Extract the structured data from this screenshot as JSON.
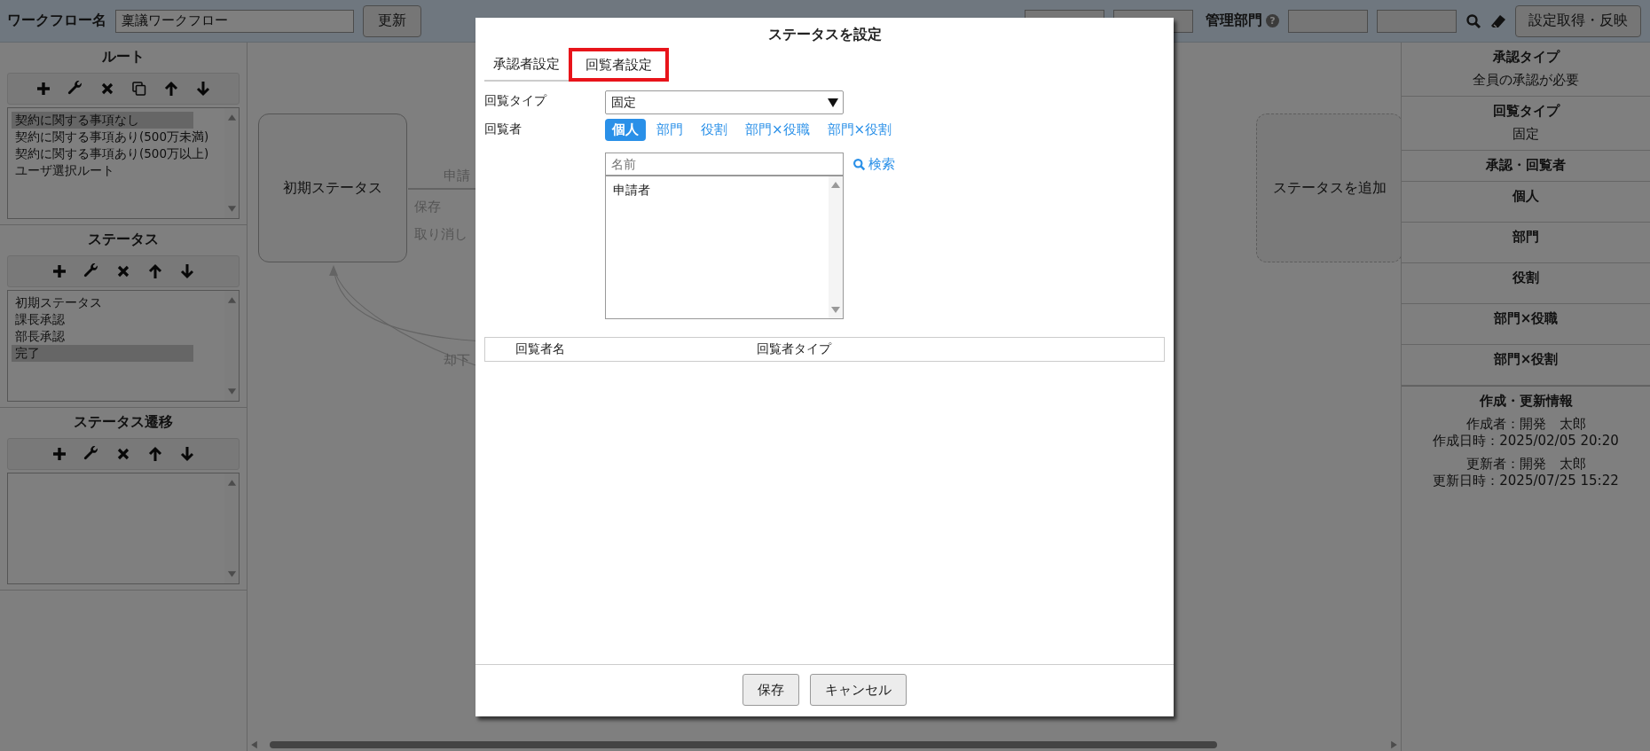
{
  "header": {
    "workflow_label": "ワークフロー名",
    "workflow_name": "稟議ワークフロー",
    "update_button": "更新",
    "department_label": "管理部門",
    "help_mark": "?",
    "apply_button": "設定取得・反映"
  },
  "sidebar": {
    "sections": [
      {
        "title": "ルート",
        "tools": [
          {
            "kind": "add"
          },
          {
            "kind": "edit"
          },
          {
            "kind": "delete"
          },
          {
            "kind": "copy"
          },
          {
            "kind": "up"
          },
          {
            "kind": "down"
          }
        ],
        "items": [
          {
            "label": "契約に関する事項なし",
            "selected": true
          },
          {
            "label": "契約に関する事項あり(500万未満)",
            "selected": false
          },
          {
            "label": "契約に関する事項あり(500万以上)",
            "selected": false
          },
          {
            "label": "ユーザ選択ルート",
            "selected": false
          }
        ]
      },
      {
        "title": "ステータス",
        "tools": [
          {
            "kind": "add"
          },
          {
            "kind": "edit"
          },
          {
            "kind": "delete"
          },
          {
            "kind": "up"
          },
          {
            "kind": "down"
          }
        ],
        "items": [
          {
            "label": "初期ステータス",
            "selected": false
          },
          {
            "label": "課長承認",
            "selected": false
          },
          {
            "label": "部長承認",
            "selected": false
          },
          {
            "label": "完了",
            "selected": true
          }
        ]
      },
      {
        "title": "ステータス遷移",
        "tools": [
          {
            "kind": "add"
          },
          {
            "kind": "edit"
          },
          {
            "kind": "delete"
          },
          {
            "kind": "up"
          },
          {
            "kind": "down"
          }
        ]
      }
    ]
  },
  "canvas": {
    "nodes": [
      {
        "kind": "status",
        "label": "初期ステータス"
      },
      {
        "kind": "add",
        "label": "ステータスを追加"
      }
    ],
    "edge_labels": [
      "申請",
      "保存",
      "取り消し",
      "却下"
    ]
  },
  "info_panel": {
    "sections": [
      {
        "heading": "承認タイプ",
        "value": "全員の承認が必要"
      },
      {
        "heading": "回覧タイプ",
        "value": "固定"
      },
      {
        "heading": "承認・回覧者"
      },
      {
        "heading": "個人",
        "kind": "tall"
      },
      {
        "heading": "部門",
        "kind": "tall"
      },
      {
        "heading": "役割",
        "kind": "tall"
      },
      {
        "heading": "部門×役職",
        "kind": "tall"
      },
      {
        "heading": "部門×役割",
        "kind": "tall"
      }
    ],
    "audit": {
      "heading": "作成・更新情報",
      "groups": [
        [
          "作成者：開発　太郎",
          "作成日時：2025/02/05 20:20"
        ],
        [
          "更新者：開発　太郎",
          "更新日時：2025/07/25 15:22"
        ]
      ]
    }
  },
  "dialog": {
    "title": "ステータスを設定",
    "tabs": [
      {
        "label": "承認者設定",
        "selected": false,
        "highlighted": false
      },
      {
        "label": "回覧者設定",
        "selected": true,
        "highlighted": true
      }
    ],
    "type_label": "回覧タイプ",
    "type_value": "固定",
    "circulator_label": "回覧者",
    "circulator_kinds": [
      {
        "label": "個人",
        "selected": true
      },
      {
        "label": "部門",
        "selected": false
      },
      {
        "label": "役割",
        "selected": false
      },
      {
        "label": "部門×役職",
        "selected": false
      },
      {
        "label": "部門×役割",
        "selected": false
      }
    ],
    "search": {
      "placeholder": "名前",
      "button": "検索"
    },
    "candidates": [
      {
        "label": "申請者",
        "selected": false
      }
    ],
    "table": {
      "columns": [
        "回覧者名",
        "回覧者タイプ"
      ]
    },
    "buttons": [
      "保存",
      "キャンセル"
    ]
  }
}
